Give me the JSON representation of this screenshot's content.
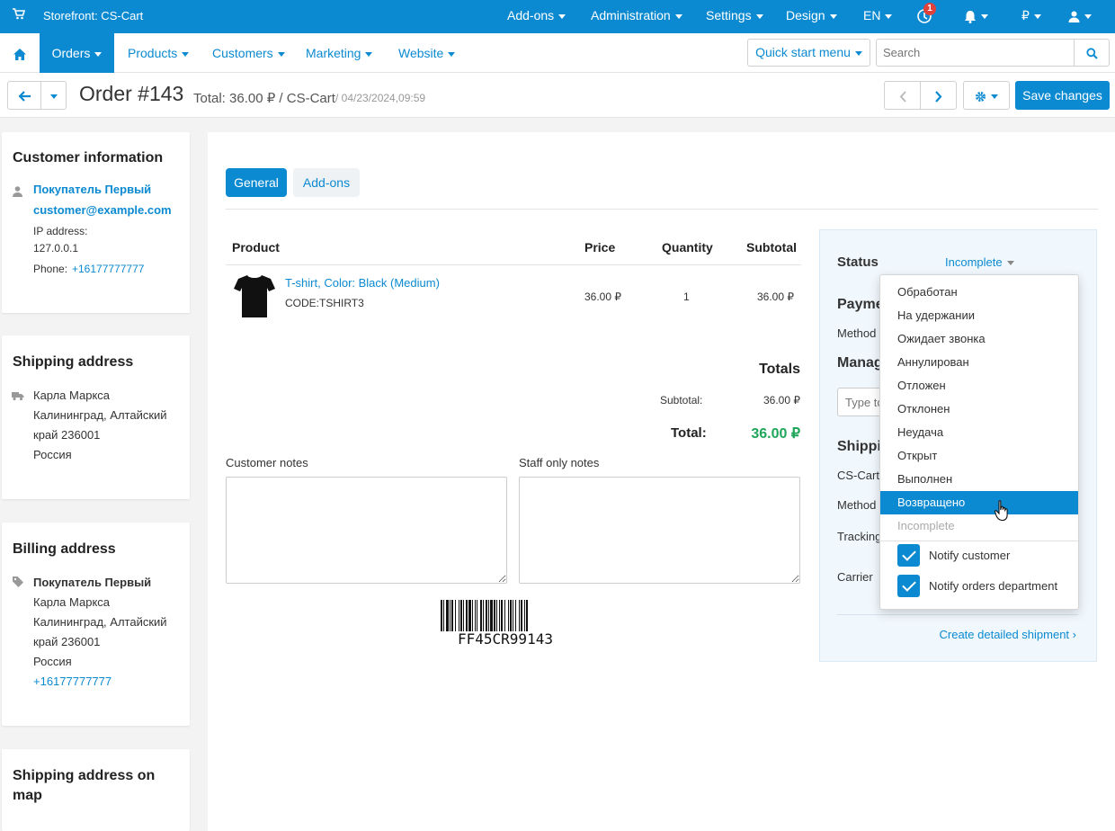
{
  "topbar": {
    "store": "Storefront: CS-Cart",
    "addons": "Add-ons",
    "administration": "Administration",
    "settings": "Settings",
    "design": "Design",
    "language": "EN",
    "notification_count": "1",
    "currency": "₽"
  },
  "nav": {
    "orders": "Orders",
    "products": "Products",
    "customers": "Customers",
    "marketing": "Marketing",
    "website": "Website",
    "quick_start": "Quick start menu",
    "search_placeholder": "Search"
  },
  "header": {
    "order_title": "Order #143",
    "total_info": "Total: 36.00 ₽ / CS-Cart",
    "date": "/ 04/23/2024,09:59",
    "save": "Save changes"
  },
  "customer": {
    "title": "Customer information",
    "name": "Покупатель Первый",
    "email": "customer@example.com",
    "ip_label": "IP address:",
    "ip": "127.0.0.1",
    "phone_label": "Phone:",
    "phone": "+16177777777"
  },
  "shipping_address": {
    "title": "Shipping address",
    "line1": "Карла Маркса",
    "line2": "Калининград, Алтайский",
    "line3": "край 236001",
    "line4": "Россия"
  },
  "billing_address": {
    "title": "Billing address",
    "name": "Покупатель Первый",
    "line1": "Карла Маркса",
    "line2": "Калининград, Алтайский",
    "line3": "край 236001",
    "line4": "Россия",
    "phone": "+16177777777"
  },
  "map_card": {
    "title_line1": "Shipping address on",
    "title_line2": "map"
  },
  "tabs": {
    "general": "General",
    "addons": "Add-ons"
  },
  "products_table": {
    "headers": {
      "product": "Product",
      "price": "Price",
      "quantity": "Quantity",
      "subtotal": "Subtotal"
    },
    "rows": [
      {
        "name": "T-shirt, Color: Black (Medium)",
        "code": "CODE:TSHIRT3",
        "price": "36.00 ₽",
        "quantity": "1",
        "subtotal": "36.00 ₽"
      }
    ]
  },
  "totals": {
    "title": "Totals",
    "subtotal_label": "Subtotal:",
    "subtotal_value": "36.00 ₽",
    "total_label": "Total:",
    "total_value": "36.00 ₽"
  },
  "notes": {
    "customer_label": "Customer notes",
    "staff_label": "Staff only notes"
  },
  "barcode": {
    "code": "FF45CR99143"
  },
  "side_panel": {
    "status_label": "Status",
    "status_value": "Incomplete",
    "payment_partial": "Payme",
    "method_label": "Method",
    "manager_partial": "Manag",
    "manager_placeholder": "Type to",
    "shipping_partial": "Shippi",
    "shipping_store": "CS-Cart",
    "method2_label": "Method",
    "tracking_label": "Tracking",
    "carrier_label": "Carrier",
    "create_shipment": "Create detailed shipment"
  },
  "status_menu": {
    "items": [
      "Обработан",
      "На удержании",
      "Ожидает звонка",
      "Аннулирован",
      "Отложен",
      "Отклонен",
      "Неудача",
      "Открыт",
      "Выполнен",
      "Возвращено",
      "Incomplete"
    ],
    "notify_customer": "Notify customer",
    "notify_orders": "Notify orders department"
  },
  "colors": {
    "accent": "#0b8ad1",
    "total_green": "#1fa55a"
  }
}
